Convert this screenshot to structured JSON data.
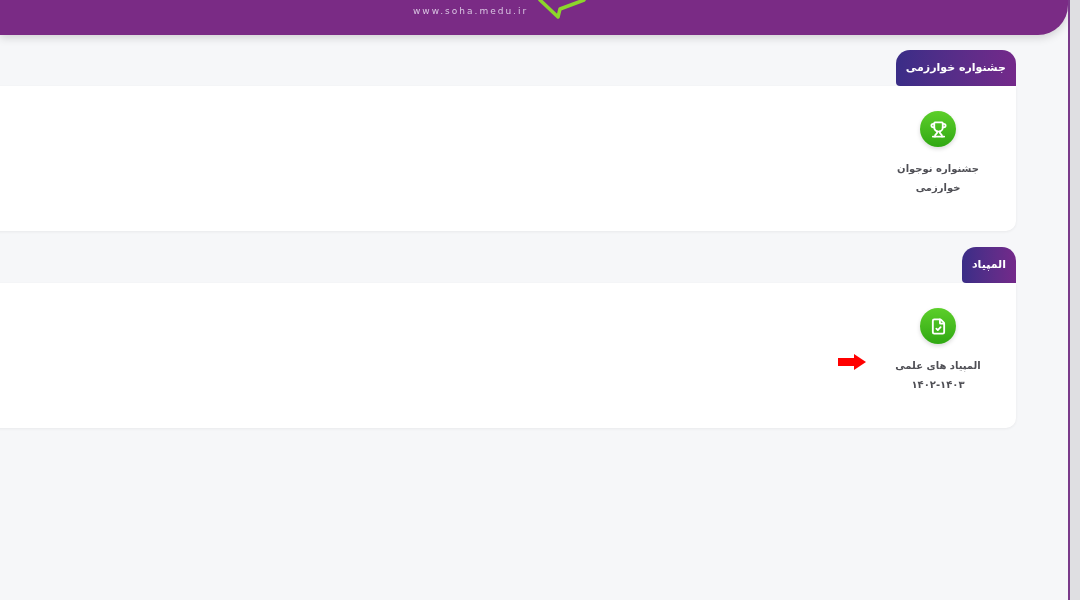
{
  "header": {
    "site_url": "www.soha.medu.ir"
  },
  "sections": [
    {
      "title": "جشنواره خوارزمی",
      "items": [
        {
          "kind": "trophy",
          "label_lines": [
            "جشنواره نوجوان",
            "خوارزمی"
          ],
          "pointed": false
        }
      ]
    },
    {
      "title": "المپیاد",
      "items": [
        {
          "kind": "document",
          "label_lines": [
            "المپیاد های علمی",
            "۱۴۰۲-۱۴۰۳"
          ],
          "pointed": true
        }
      ]
    }
  ]
}
